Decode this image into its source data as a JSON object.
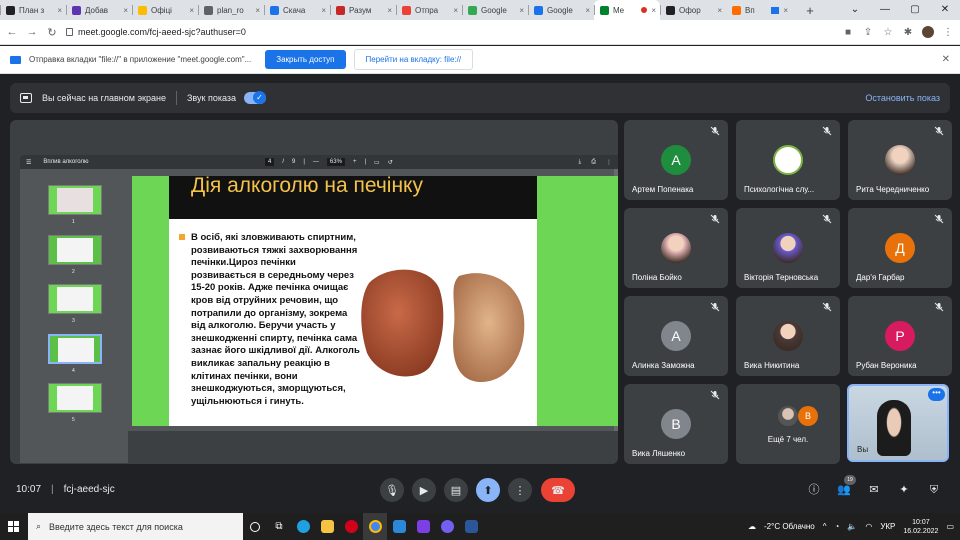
{
  "browser": {
    "tabs": [
      {
        "label": "План з",
        "favicon_color": "#202124"
      },
      {
        "label": "Добав",
        "favicon_color": "#5e35b1"
      },
      {
        "label": "Офіці",
        "favicon_color": "#fbbc04"
      },
      {
        "label": "plan_ro",
        "favicon_color": "#5f6368"
      },
      {
        "label": "Скача",
        "favicon_color": "#1a73e8"
      },
      {
        "label": "Разум",
        "favicon_color": "#c62828"
      },
      {
        "label": "Отпра",
        "favicon_color": "#ea4335"
      },
      {
        "label": "Google",
        "favicon_color": "#34a853"
      },
      {
        "label": "Google",
        "favicon_color": "#1a73e8"
      },
      {
        "label": "Me",
        "favicon_color": "#00832d"
      },
      {
        "label": "Офор",
        "favicon_color": "#202124"
      },
      {
        "label": "Вп",
        "favicon_color": "#ff6d00"
      }
    ],
    "tab_close": "×",
    "new_tab": "+",
    "window_controls": [
      "⌄",
      "—",
      "▢",
      "✕"
    ],
    "url": "meet.google.com/fcj-aeed-sjc?authuser=0"
  },
  "infobar": {
    "text": "Отправка вкладки \"file://\" в приложение \"meet.google.com\"...",
    "share_button": "Закрыть доступ",
    "switch_button": "Перейти на вкладку: file://",
    "close": "✕"
  },
  "banner": {
    "presenting_text": "Вы сейчас на главном экране",
    "audio_label": "Звук показа",
    "stop_label": "Остановить показ"
  },
  "pdf": {
    "doc_title": "Вплив алкоголю",
    "page_current": "4",
    "page_total": "9",
    "zoom": "63%",
    "thumb_numbers": [
      "1",
      "2",
      "3",
      "4",
      "5"
    ],
    "selected_thumb_index": 3
  },
  "slide": {
    "title": "Дія алкоголю на печінку",
    "body": "В осіб, які зловживають спиртним, розвиваються тяжкі захворювання печінки.Цироз печінки розвивається в середньому через 15-20 років. Адже печінка очищає кров від отруйних речовин, що потрапили до організму, зокрема від алкоголю. Беручи участь у знешкодженні спирту, печінка сама зазнає його шкідливої дії. Алкоголь викликає запальну реакцію в клітинах печінки, вони знешкоджуються, зморщуються, ущільнюються і гинуть.",
    "accent_color": "#f3c24a",
    "border_color": "#6dd655"
  },
  "participants": [
    {
      "name": "Артем Попенака",
      "initial": "А",
      "color": "#1e8e3e",
      "type": "letter"
    },
    {
      "name": "Психологічна слу...",
      "initial": "",
      "color": "#ffffff",
      "type": "logo"
    },
    {
      "name": "Рита Чередниченко",
      "initial": "",
      "color": "#e8d0c0",
      "type": "photo"
    },
    {
      "name": "Поліна Бойко",
      "initial": "",
      "color": "#f0c0c0",
      "type": "photo"
    },
    {
      "name": "Вікторія Терновська",
      "initial": "",
      "color": "#6a5acd",
      "type": "photo"
    },
    {
      "name": "Дар'я Гарбар",
      "initial": "Д",
      "color": "#e8710a",
      "type": "letter"
    },
    {
      "name": "Алинка Заможна",
      "initial": "А",
      "color": "#80868b",
      "type": "letter"
    },
    {
      "name": "Вика Никитина",
      "initial": "",
      "color": "#4a3a3a",
      "type": "photo"
    },
    {
      "name": "Рубан Вероника",
      "initial": "Р",
      "color": "#d81b60",
      "type": "letter"
    },
    {
      "name": "Вика Ляшенко",
      "initial": "В",
      "color": "#80868b",
      "type": "letter"
    },
    {
      "name": "Ещё 7 чел.",
      "initial": "В",
      "color": "#e8710a",
      "type": "more"
    },
    {
      "name": "Вы",
      "initial": "",
      "color": "#b7c9d8",
      "type": "self"
    }
  ],
  "self_menu": "•••",
  "controls": {
    "time": "10:07",
    "meeting_code": "fcj-aeed-sjc",
    "participant_count": "19"
  },
  "taskbar": {
    "search_placeholder": "Введите здесь текст для поиска",
    "weather": "-2°C Облачно",
    "lang": "УКР",
    "time": "10:07",
    "date": "16.02.2022"
  }
}
